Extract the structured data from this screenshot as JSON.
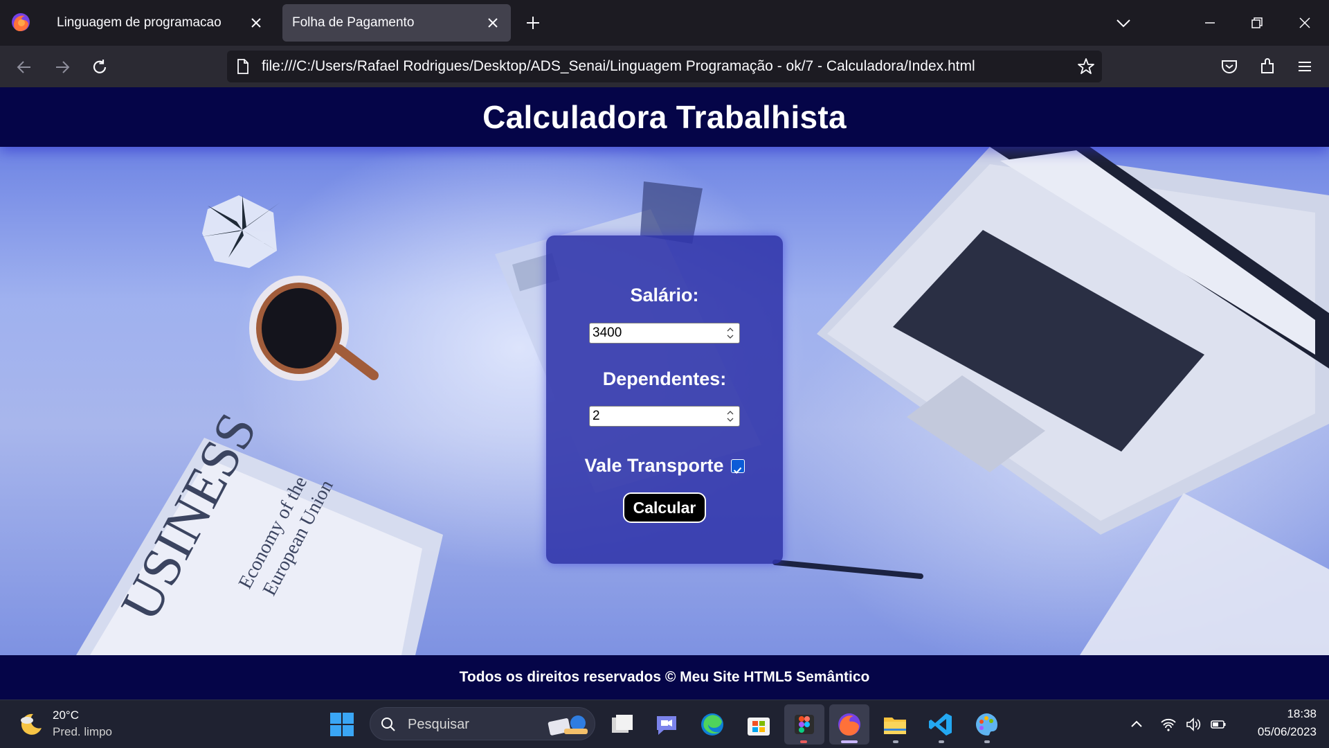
{
  "browser": {
    "tabs": [
      {
        "label": "Linguagem de programacao",
        "active": false
      },
      {
        "label": "Folha de Pagamento",
        "active": true
      }
    ],
    "url": "file:///C:/Users/Rafael Rodrigues/Desktop/ADS_Senai/Linguagem Programação - ok/7 - Calculadora/Index.html"
  },
  "site": {
    "title": "Calculadora Trabalhista",
    "form": {
      "salario_label": "Salário:",
      "salario_value": "3400",
      "dependentes_label": "Dependentes:",
      "dependentes_value": "2",
      "vale_transporte_label": "Vale Transporte",
      "vale_transporte_checked": true,
      "button_label": "Calcular"
    },
    "footer": "Todos os direitos reservados © Meu Site HTML5 Semântico"
  },
  "taskbar": {
    "weather": {
      "temp": "20°C",
      "desc": "Pred. limpo"
    },
    "search_placeholder": "Pesquisar",
    "clock": {
      "time": "18:38",
      "date": "05/06/2023"
    }
  },
  "colors": {
    "header_bg": "#050548",
    "card_bg": "#3034aa",
    "accent_checkbox": "#0b5bd7"
  }
}
